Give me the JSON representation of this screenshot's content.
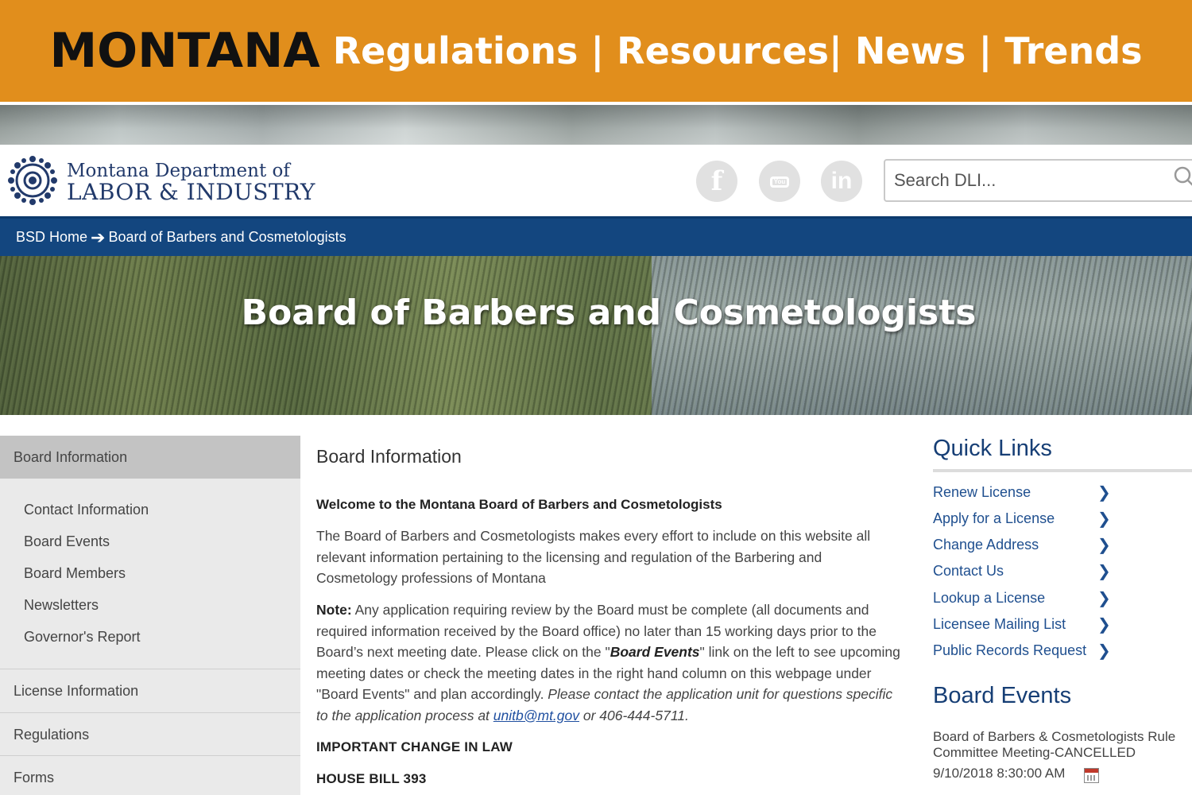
{
  "banner": {
    "state": "MONTANA",
    "topics": "Regulations | Resources| News | Trends"
  },
  "header": {
    "logo_line1": "Montana Department of",
    "logo_line2": "LABOR & INDUSTRY",
    "social": {
      "facebook_glyph": "f",
      "youtube_glyph": "You",
      "linkedin_glyph": "in"
    },
    "search_placeholder": "Search DLI..."
  },
  "breadcrumb": {
    "home": "BSD Home",
    "separator": "➔",
    "current": "Board of Barbers and Cosmetologists"
  },
  "hero": {
    "title": "Board of Barbers and Cosmetologists"
  },
  "sidebar": {
    "active": "Board Information",
    "sub_items": [
      "Contact Information",
      "Board Events",
      "Board Members",
      "Newsletters",
      "Governor's Report"
    ],
    "sections": [
      "License Information",
      "Regulations",
      "Forms"
    ]
  },
  "main": {
    "heading": "Board Information",
    "welcome": "Welcome to the Montana Board of Barbers and Cosmetologists",
    "intro": "The Board of Barbers and Cosmetologists makes every effort to include on this website all relevant information pertaining to the licensing and regulation of the Barbering and Cosmetology professions of Montana",
    "note": {
      "label": "Note:",
      "text1": " Any application requiring review by the Board must be complete (all documents and required information received by the Board office) no later than 15 working days prior to the Board’s next meeting date. Please click on the \"",
      "link_em": "Board Events",
      "text2": "\" link on the left to see upcoming meeting dates or check the  meeting dates in the right hand column on this webpage under \"Board Events\" and plan accordingly. ",
      "italic1": "Please contact the application unit for questions specific to the application process at ",
      "email": "unitb@mt.gov",
      "italic2": " or 406-444-5711."
    },
    "important": "IMPORTANT CHANGE IN LAW",
    "bill": "HOUSE BILL 393"
  },
  "quick_links": {
    "title": "Quick Links",
    "items": [
      "Renew License",
      "Apply for a License",
      "Change Address",
      "Contact Us",
      "Lookup a License",
      "Licensee Mailing List",
      "Public Records Request"
    ],
    "chevron": "❯"
  },
  "board_events": {
    "title": "Board Events",
    "event": "Board of Barbers & Cosmetologists Rule Committee Meeting-CANCELLED",
    "date": "9/10/2018 8:30:00 AM",
    "icon": "calendar-icon"
  },
  "colors": {
    "banner": "#e18e1c",
    "nav_blue": "#13467f",
    "link_blue": "#1f4f8f",
    "heading_blue": "#163e75"
  }
}
